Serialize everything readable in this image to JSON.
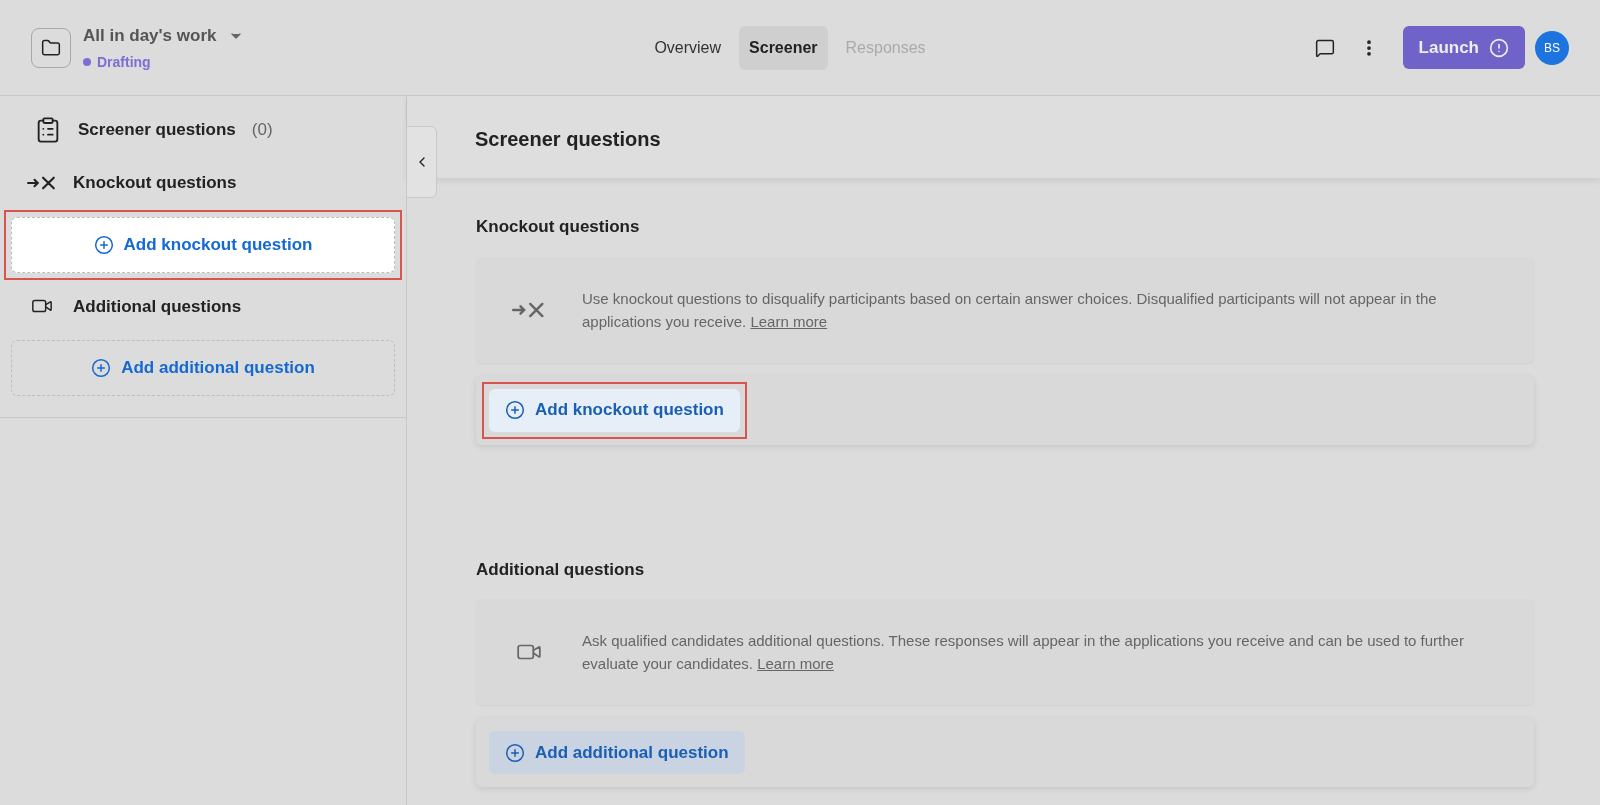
{
  "project": {
    "title": "All in day's work",
    "status": "Drafting"
  },
  "tabs": [
    {
      "label": "Overview",
      "selected": false,
      "disabled": false
    },
    {
      "label": "Screener",
      "selected": true,
      "disabled": false
    },
    {
      "label": "Responses",
      "selected": false,
      "disabled": true
    }
  ],
  "launch_button": {
    "label": "Launch"
  },
  "avatar": {
    "initials": "BS"
  },
  "sidebar": {
    "title": "Screener questions",
    "count": "(0)",
    "sections": [
      {
        "kind": "knockout",
        "label": "Knockout questions",
        "add_label": "Add knockout question",
        "highlighted": true
      },
      {
        "kind": "additional",
        "label": "Additional questions",
        "add_label": "Add additional question",
        "highlighted": false
      }
    ]
  },
  "main": {
    "title": "Screener questions",
    "sections": [
      {
        "kind": "knockout",
        "heading": "Knockout questions",
        "description": "Use knockout questions to disqualify participants based on certain answer choices. Disqualified participants will not appear in the applications you receive.",
        "link": "Learn more",
        "add_label": "Add knockout question",
        "highlighted": true
      },
      {
        "kind": "additional",
        "heading": "Additional questions",
        "description": "Ask qualified candidates additional questions. These responses will appear in the applications you receive and can be used to further evaluate your candidates.",
        "link": "Learn more",
        "add_label": "Add additional question",
        "highlighted": false
      }
    ]
  }
}
